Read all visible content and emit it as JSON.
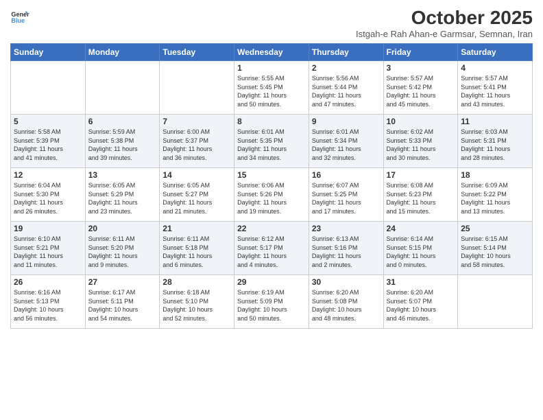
{
  "header": {
    "logo_line1": "General",
    "logo_line2": "Blue",
    "month": "October 2025",
    "location": "Istgah-e Rah Ahan-e Garmsar, Semnan, Iran"
  },
  "weekdays": [
    "Sunday",
    "Monday",
    "Tuesday",
    "Wednesday",
    "Thursday",
    "Friday",
    "Saturday"
  ],
  "weeks": [
    [
      {
        "day": "",
        "info": ""
      },
      {
        "day": "",
        "info": ""
      },
      {
        "day": "",
        "info": ""
      },
      {
        "day": "1",
        "info": "Sunrise: 5:55 AM\nSunset: 5:45 PM\nDaylight: 11 hours\nand 50 minutes."
      },
      {
        "day": "2",
        "info": "Sunrise: 5:56 AM\nSunset: 5:44 PM\nDaylight: 11 hours\nand 47 minutes."
      },
      {
        "day": "3",
        "info": "Sunrise: 5:57 AM\nSunset: 5:42 PM\nDaylight: 11 hours\nand 45 minutes."
      },
      {
        "day": "4",
        "info": "Sunrise: 5:57 AM\nSunset: 5:41 PM\nDaylight: 11 hours\nand 43 minutes."
      }
    ],
    [
      {
        "day": "5",
        "info": "Sunrise: 5:58 AM\nSunset: 5:39 PM\nDaylight: 11 hours\nand 41 minutes."
      },
      {
        "day": "6",
        "info": "Sunrise: 5:59 AM\nSunset: 5:38 PM\nDaylight: 11 hours\nand 39 minutes."
      },
      {
        "day": "7",
        "info": "Sunrise: 6:00 AM\nSunset: 5:37 PM\nDaylight: 11 hours\nand 36 minutes."
      },
      {
        "day": "8",
        "info": "Sunrise: 6:01 AM\nSunset: 5:35 PM\nDaylight: 11 hours\nand 34 minutes."
      },
      {
        "day": "9",
        "info": "Sunrise: 6:01 AM\nSunset: 5:34 PM\nDaylight: 11 hours\nand 32 minutes."
      },
      {
        "day": "10",
        "info": "Sunrise: 6:02 AM\nSunset: 5:33 PM\nDaylight: 11 hours\nand 30 minutes."
      },
      {
        "day": "11",
        "info": "Sunrise: 6:03 AM\nSunset: 5:31 PM\nDaylight: 11 hours\nand 28 minutes."
      }
    ],
    [
      {
        "day": "12",
        "info": "Sunrise: 6:04 AM\nSunset: 5:30 PM\nDaylight: 11 hours\nand 26 minutes."
      },
      {
        "day": "13",
        "info": "Sunrise: 6:05 AM\nSunset: 5:29 PM\nDaylight: 11 hours\nand 23 minutes."
      },
      {
        "day": "14",
        "info": "Sunrise: 6:05 AM\nSunset: 5:27 PM\nDaylight: 11 hours\nand 21 minutes."
      },
      {
        "day": "15",
        "info": "Sunrise: 6:06 AM\nSunset: 5:26 PM\nDaylight: 11 hours\nand 19 minutes."
      },
      {
        "day": "16",
        "info": "Sunrise: 6:07 AM\nSunset: 5:25 PM\nDaylight: 11 hours\nand 17 minutes."
      },
      {
        "day": "17",
        "info": "Sunrise: 6:08 AM\nSunset: 5:23 PM\nDaylight: 11 hours\nand 15 minutes."
      },
      {
        "day": "18",
        "info": "Sunrise: 6:09 AM\nSunset: 5:22 PM\nDaylight: 11 hours\nand 13 minutes."
      }
    ],
    [
      {
        "day": "19",
        "info": "Sunrise: 6:10 AM\nSunset: 5:21 PM\nDaylight: 11 hours\nand 11 minutes."
      },
      {
        "day": "20",
        "info": "Sunrise: 6:11 AM\nSunset: 5:20 PM\nDaylight: 11 hours\nand 9 minutes."
      },
      {
        "day": "21",
        "info": "Sunrise: 6:11 AM\nSunset: 5:18 PM\nDaylight: 11 hours\nand 6 minutes."
      },
      {
        "day": "22",
        "info": "Sunrise: 6:12 AM\nSunset: 5:17 PM\nDaylight: 11 hours\nand 4 minutes."
      },
      {
        "day": "23",
        "info": "Sunrise: 6:13 AM\nSunset: 5:16 PM\nDaylight: 11 hours\nand 2 minutes."
      },
      {
        "day": "24",
        "info": "Sunrise: 6:14 AM\nSunset: 5:15 PM\nDaylight: 11 hours\nand 0 minutes."
      },
      {
        "day": "25",
        "info": "Sunrise: 6:15 AM\nSunset: 5:14 PM\nDaylight: 10 hours\nand 58 minutes."
      }
    ],
    [
      {
        "day": "26",
        "info": "Sunrise: 6:16 AM\nSunset: 5:13 PM\nDaylight: 10 hours\nand 56 minutes."
      },
      {
        "day": "27",
        "info": "Sunrise: 6:17 AM\nSunset: 5:11 PM\nDaylight: 10 hours\nand 54 minutes."
      },
      {
        "day": "28",
        "info": "Sunrise: 6:18 AM\nSunset: 5:10 PM\nDaylight: 10 hours\nand 52 minutes."
      },
      {
        "day": "29",
        "info": "Sunrise: 6:19 AM\nSunset: 5:09 PM\nDaylight: 10 hours\nand 50 minutes."
      },
      {
        "day": "30",
        "info": "Sunrise: 6:20 AM\nSunset: 5:08 PM\nDaylight: 10 hours\nand 48 minutes."
      },
      {
        "day": "31",
        "info": "Sunrise: 6:20 AM\nSunset: 5:07 PM\nDaylight: 10 hours\nand 46 minutes."
      },
      {
        "day": "",
        "info": ""
      }
    ]
  ]
}
